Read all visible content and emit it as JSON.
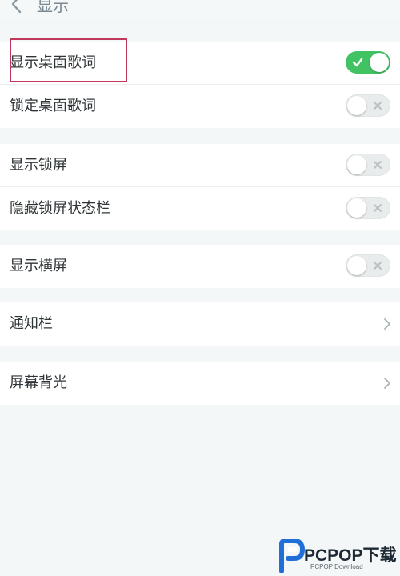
{
  "header": {
    "title": "显示"
  },
  "groups": [
    {
      "items": [
        {
          "label": "显示桌面歌词",
          "toggle": "on"
        },
        {
          "label": "锁定桌面歌词",
          "toggle": "off"
        }
      ]
    },
    {
      "items": [
        {
          "label": "显示锁屏",
          "toggle": "off"
        },
        {
          "label": "隐藏锁屏状态栏",
          "toggle": "off"
        }
      ]
    },
    {
      "items": [
        {
          "label": "显示横屏",
          "toggle": "off"
        }
      ]
    },
    {
      "items": [
        {
          "label": "通知栏",
          "icon": "chevron-right-icon"
        }
      ]
    },
    {
      "items": [
        {
          "label": "屏幕背光",
          "icon": "chevron-right-icon"
        }
      ]
    }
  ],
  "colors": {
    "toggle_on": "#41c364",
    "toggle_off": "#e9ecec",
    "highlight_box": "#c0395c",
    "background": "#f3f7f7"
  },
  "watermark": {
    "brand": "PCPOP下载",
    "sub": "PCPOP Download"
  }
}
